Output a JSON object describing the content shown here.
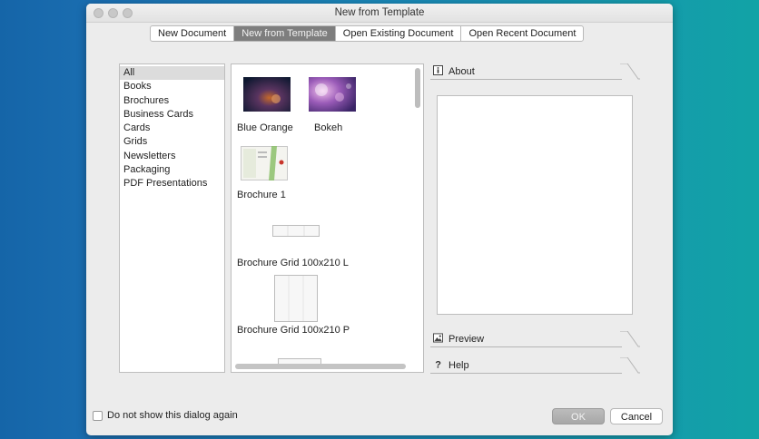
{
  "window": {
    "title": "New from Template"
  },
  "tabs": [
    {
      "label": "New Document",
      "active": false
    },
    {
      "label": "New from Template",
      "active": true
    },
    {
      "label": "Open Existing Document",
      "active": false
    },
    {
      "label": "Open Recent Document",
      "active": false
    }
  ],
  "categories": [
    {
      "label": "All",
      "selected": true
    },
    {
      "label": "Books"
    },
    {
      "label": "Brochures"
    },
    {
      "label": "Business Cards"
    },
    {
      "label": "Cards"
    },
    {
      "label": "Grids"
    },
    {
      "label": "Newsletters"
    },
    {
      "label": "Packaging"
    },
    {
      "label": "PDF Presentations"
    }
  ],
  "templates": [
    {
      "label": "Blue Orange",
      "thumb": "dark-blue-orange"
    },
    {
      "label": "Bokeh",
      "thumb": "purple-bokeh"
    },
    {
      "label": "Brochure 1",
      "thumb": "brochure-fold"
    },
    {
      "label": "Brochure Grid 100x210 L",
      "thumb": "landscape-grid"
    },
    {
      "label": "Brochure Grid 100x210 P",
      "thumb": "portrait-grid"
    }
  ],
  "panels": {
    "about": {
      "label": "About",
      "icon": "info-icon"
    },
    "preview": {
      "label": "Preview",
      "icon": "image-icon"
    },
    "help": {
      "label": "Help",
      "icon": "question-icon"
    }
  },
  "footer": {
    "dont_show_label": "Do not show this dialog again",
    "dont_show_checked": false,
    "ok_label": "OK",
    "cancel_label": "Cancel"
  },
  "colors": {
    "desktop_left": "#1565a8",
    "desktop_right": "#12a3a6",
    "active_tab": "#7e7e7e"
  }
}
